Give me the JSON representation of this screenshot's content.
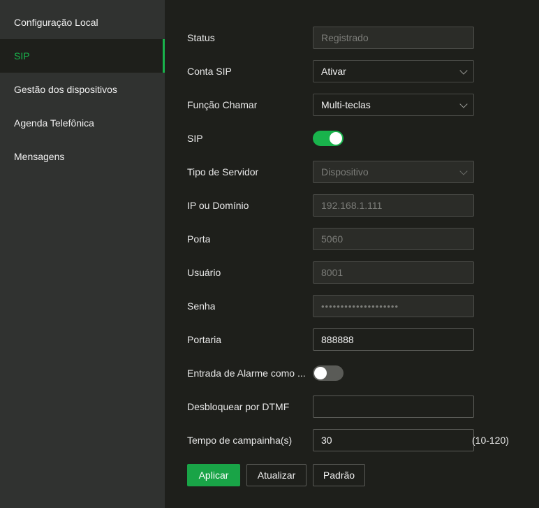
{
  "sidebar": {
    "items": [
      {
        "label": "Configuração Local"
      },
      {
        "label": "SIP"
      },
      {
        "label": "Gestão dos dispositivos"
      },
      {
        "label": "Agenda Telefônica"
      },
      {
        "label": "Mensagens"
      }
    ]
  },
  "form": {
    "status": {
      "label": "Status",
      "value": "Registrado"
    },
    "conta_sip": {
      "label": "Conta SIP",
      "value": "Ativar"
    },
    "funcao_chamar": {
      "label": "Função Chamar",
      "value": "Multi-teclas"
    },
    "sip": {
      "label": "SIP",
      "state": "on"
    },
    "tipo_servidor": {
      "label": "Tipo de Servidor",
      "value": "Dispositivo"
    },
    "ip_dominio": {
      "label": "IP ou Domínio",
      "value": "192.168.1.111"
    },
    "porta": {
      "label": "Porta",
      "value": "5060"
    },
    "usuario": {
      "label": "Usuário",
      "value": "8001"
    },
    "senha": {
      "label": "Senha",
      "value": "••••••••••••••••••••"
    },
    "portaria": {
      "label": "Portaria",
      "value": "888888"
    },
    "entrada_alarme": {
      "label": "Entrada de Alarme como ...",
      "state": "off"
    },
    "desbloquear_dtmf": {
      "label": "Desbloquear por DTMF",
      "value": ""
    },
    "tempo_campainha": {
      "label": "Tempo de campainha(s)",
      "value": "30",
      "hint": "(10-120)"
    }
  },
  "buttons": {
    "apply": "Aplicar",
    "refresh": "Atualizar",
    "default": "Padrão"
  },
  "colors": {
    "accent": "#19b34c",
    "background": "#1e1f1b",
    "sidebar": "#303230"
  },
  "icons": {
    "dropdown": "chevron-down-icon"
  }
}
